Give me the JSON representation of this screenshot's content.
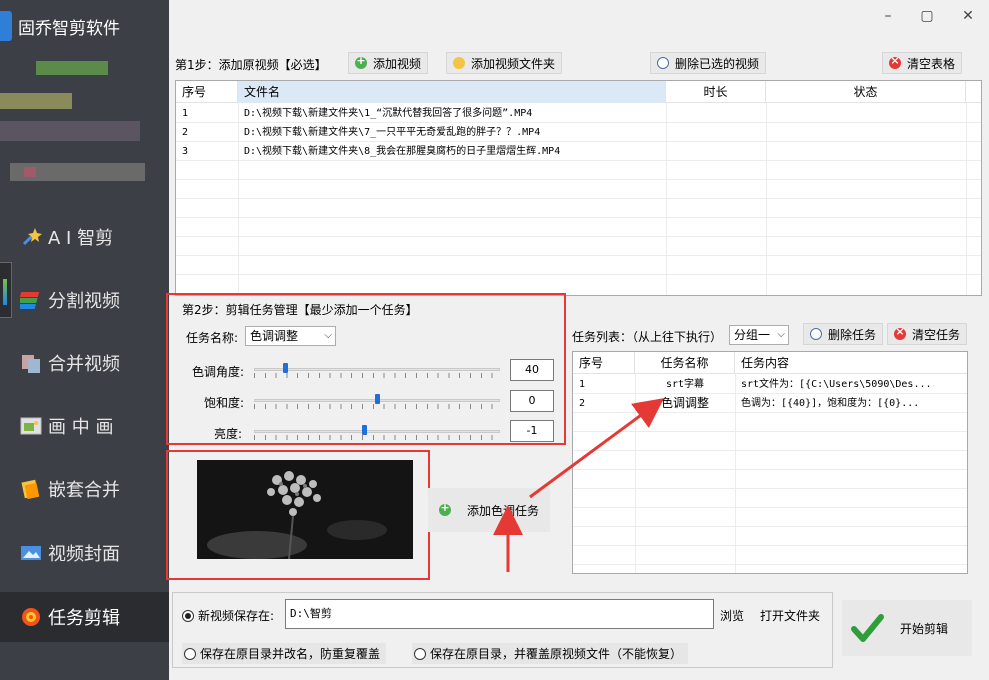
{
  "app": {
    "title": "固乔智剪软件"
  },
  "sidebar": {
    "items": [
      {
        "label": "A I 智剪",
        "icon": "ai-wand-icon"
      },
      {
        "label": "分割视频",
        "icon": "split-video-icon"
      },
      {
        "label": "合并视频",
        "icon": "merge-video-icon"
      },
      {
        "label": "画 中 画",
        "icon": "picture-in-picture-icon"
      },
      {
        "label": "嵌套合并",
        "icon": "nested-merge-icon"
      },
      {
        "label": "视频封面",
        "icon": "video-cover-icon"
      },
      {
        "label": "任务剪辑",
        "icon": "task-edit-icon",
        "active": true
      }
    ]
  },
  "step1": {
    "label": "第1步：添加原视频【必选】",
    "add_video": "添加视频",
    "add_folder": "添加视频文件夹",
    "delete_selected": "删除已选的视频",
    "clear_table": "清空表格",
    "columns": [
      "序号",
      "文件名",
      "时长",
      "状态"
    ],
    "rows": [
      {
        "no": "1",
        "file": "D:\\视频下载\\新建文件夹\\1_“沉默代替我回答了很多问题”.MP4",
        "duration": "",
        "status": ""
      },
      {
        "no": "2",
        "file": "D:\\视频下载\\新建文件夹\\7_一只平平无奇爱乱跑的胖子？？.MP4",
        "duration": "",
        "status": ""
      },
      {
        "no": "3",
        "file": "D:\\视频下载\\新建文件夹\\8_我会在那腥臭腐朽的日子里熠熠生辉.MP4",
        "duration": "",
        "status": ""
      }
    ]
  },
  "step2": {
    "label": "第2步：剪辑任务管理【最少添加一个任务】",
    "task_name_label": "任务名称:",
    "task_name_value": "色调调整",
    "hue_label": "色调角度:",
    "hue_value": "40",
    "hue_fraction": 0.12,
    "saturation_label": "饱和度:",
    "saturation_value": "0",
    "saturation_fraction": 0.5,
    "brightness_label": "亮度:",
    "brightness_value": "-1",
    "brightness_fraction": 0.45,
    "add_task": "添加色调任务"
  },
  "tasks": {
    "label": "任务列表：（从上往下执行）",
    "group_value": "分组一",
    "delete_task": "删除任务",
    "clear_tasks": "清空任务",
    "columns": [
      "序号",
      "任务名称",
      "任务内容"
    ],
    "rows": [
      {
        "no": "1",
        "name": "srt字幕",
        "content": "srt文件为：[{C:\\Users\\5090\\Des..."
      },
      {
        "no": "2",
        "name": "色调调整",
        "content": "色调为：[{40}]，饱和度为：[{0}..."
      }
    ]
  },
  "output": {
    "save_label": "新视频保存在:",
    "save_path": "D:\\智剪",
    "browse": "浏览",
    "open_folder": "打开文件夹",
    "option_rename": "保存在原目录并改名，防重复覆盖",
    "option_overwrite": "保存在原目录，并覆盖原视频文件（不能恢复）",
    "start": "开始剪辑"
  },
  "colors": {
    "sidebar": "#3c3f45",
    "highlight_red": "#e53935",
    "accent_blue": "#1e6fd9"
  }
}
